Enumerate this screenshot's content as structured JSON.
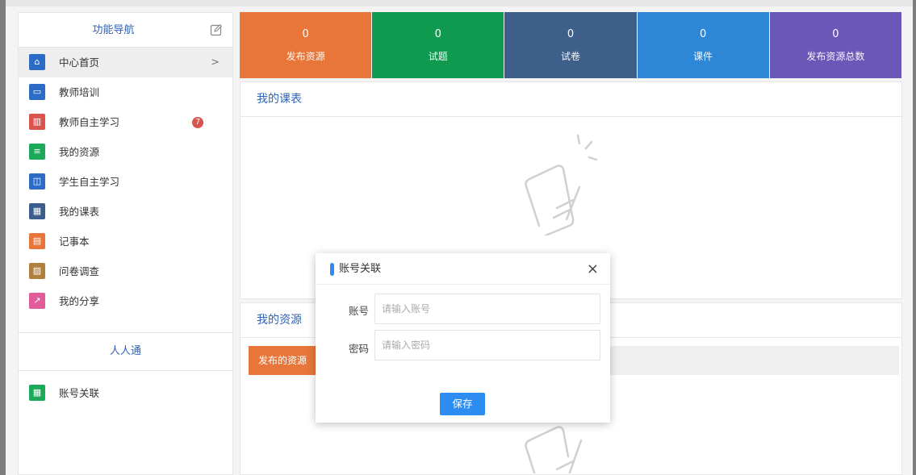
{
  "sidebar": {
    "title": "功能导航",
    "items": [
      {
        "label": "中心首页",
        "icon": "home-icon",
        "color": "#2d6cc6",
        "active": true,
        "arrow": ">"
      },
      {
        "label": "教师培训",
        "icon": "monitor-icon",
        "color": "#2d6cc6"
      },
      {
        "label": "教师自主学习",
        "icon": "book-open-icon",
        "color": "#d9534f",
        "badge": "7"
      },
      {
        "label": "我的资源",
        "icon": "document-icon",
        "color": "#1ea95a"
      },
      {
        "label": "学生自主学习",
        "icon": "reader-icon",
        "color": "#2d6cc6"
      },
      {
        "label": "我的课表",
        "icon": "grid-icon",
        "color": "#3b5e8e"
      },
      {
        "label": "记事本",
        "icon": "notepad-icon",
        "color": "#e8763a"
      },
      {
        "label": "问卷调查",
        "icon": "survey-icon",
        "color": "#b08040"
      },
      {
        "label": "我的分享",
        "icon": "share-icon",
        "color": "#e05d9a"
      }
    ],
    "section2_title": "人人通",
    "items2": [
      {
        "label": "账号关联",
        "icon": "table-icon",
        "color": "#1ea95a"
      }
    ]
  },
  "tiles": [
    {
      "num": "0",
      "label": "发布资源",
      "color": "#e8763a"
    },
    {
      "num": "0",
      "label": "试题",
      "color": "#109a50"
    },
    {
      "num": "0",
      "label": "试卷",
      "color": "#3d5f8a"
    },
    {
      "num": "0",
      "label": "课件",
      "color": "#2d86d6"
    },
    {
      "num": "0",
      "label": "发布资源总数",
      "color": "#6a57b8"
    }
  ],
  "schedule": {
    "title": "我的课表"
  },
  "resources": {
    "title": "我的资源",
    "tab": "发布的资源"
  },
  "modal": {
    "title": "账号关联",
    "close": "×",
    "account_label": "账号",
    "account_placeholder": "请输入账号",
    "password_label": "密码",
    "password_placeholder": "请输入密码",
    "save": "保存"
  }
}
